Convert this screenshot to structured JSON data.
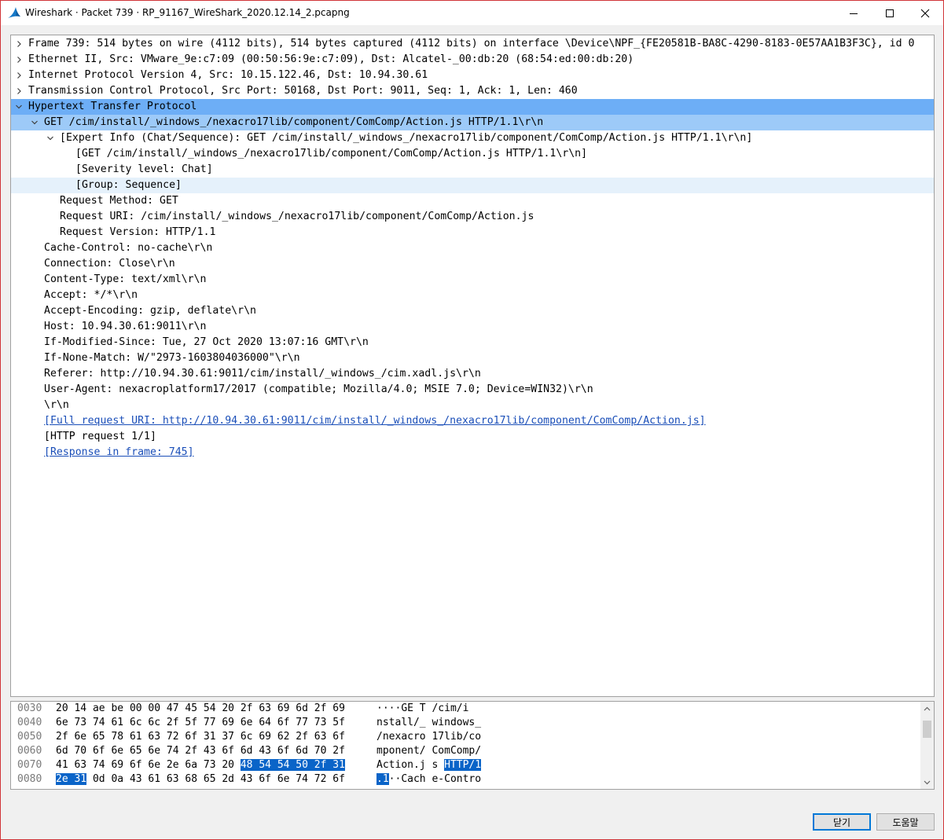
{
  "window": {
    "title": "Wireshark · Packet 739 · RP_91167_WireShark_2020.12.14_2.pcapng"
  },
  "tree": [
    {
      "indent": 0,
      "chevron": "right",
      "text": "Frame 739: 514 bytes on wire (4112 bits), 514 bytes captured (4112 bits) on interface \\Device\\NPF_{FE20581B-BA8C-4290-8183-0E57AA1B3F3C}, id 0",
      "state": ""
    },
    {
      "indent": 0,
      "chevron": "right",
      "text": "Ethernet II, Src: VMware_9e:c7:09 (00:50:56:9e:c7:09), Dst: Alcatel-_00:db:20 (68:54:ed:00:db:20)",
      "state": ""
    },
    {
      "indent": 0,
      "chevron": "right",
      "text": "Internet Protocol Version 4, Src: 10.15.122.46, Dst: 10.94.30.61",
      "state": ""
    },
    {
      "indent": 0,
      "chevron": "right",
      "text": "Transmission Control Protocol, Src Port: 50168, Dst Port: 9011, Seq: 1, Ack: 1, Len: 460",
      "state": ""
    },
    {
      "indent": 0,
      "chevron": "down",
      "text": "Hypertext Transfer Protocol",
      "state": "sel"
    },
    {
      "indent": 1,
      "chevron": "down",
      "text": "GET /cim/install/_windows_/nexacro17lib/component/ComComp/Action.js HTTP/1.1\\r\\n",
      "state": "sel2"
    },
    {
      "indent": 2,
      "chevron": "down",
      "text": "[Expert Info (Chat/Sequence): GET /cim/install/_windows_/nexacro17lib/component/ComComp/Action.js HTTP/1.1\\r\\n]",
      "state": ""
    },
    {
      "indent": 3,
      "chevron": "",
      "text": "[GET /cim/install/_windows_/nexacro17lib/component/ComComp/Action.js HTTP/1.1\\r\\n]",
      "state": ""
    },
    {
      "indent": 3,
      "chevron": "",
      "text": "[Severity level: Chat]",
      "state": ""
    },
    {
      "indent": 3,
      "chevron": "",
      "text": "[Group: Sequence]",
      "state": "hover"
    },
    {
      "indent": 2,
      "chevron": "",
      "text": "Request Method: GET",
      "state": ""
    },
    {
      "indent": 2,
      "chevron": "",
      "text": "Request URI: /cim/install/_windows_/nexacro17lib/component/ComComp/Action.js",
      "state": ""
    },
    {
      "indent": 2,
      "chevron": "",
      "text": "Request Version: HTTP/1.1",
      "state": ""
    },
    {
      "indent": 1,
      "chevron": "",
      "text": "Cache-Control: no-cache\\r\\n",
      "state": ""
    },
    {
      "indent": 1,
      "chevron": "",
      "text": "Connection: Close\\r\\n",
      "state": ""
    },
    {
      "indent": 1,
      "chevron": "",
      "text": "Content-Type: text/xml\\r\\n",
      "state": ""
    },
    {
      "indent": 1,
      "chevron": "",
      "text": "Accept: */*\\r\\n",
      "state": ""
    },
    {
      "indent": 1,
      "chevron": "",
      "text": "Accept-Encoding: gzip, deflate\\r\\n",
      "state": ""
    },
    {
      "indent": 1,
      "chevron": "",
      "text": "Host: 10.94.30.61:9011\\r\\n",
      "state": ""
    },
    {
      "indent": 1,
      "chevron": "",
      "text": "If-Modified-Since: Tue, 27 Oct 2020 13:07:16 GMT\\r\\n",
      "state": ""
    },
    {
      "indent": 1,
      "chevron": "",
      "text": "If-None-Match: W/\"2973-1603804036000\"\\r\\n",
      "state": ""
    },
    {
      "indent": 1,
      "chevron": "",
      "text": "Referer: http://10.94.30.61:9011/cim/install/_windows_/cim.xadl.js\\r\\n",
      "state": ""
    },
    {
      "indent": 1,
      "chevron": "",
      "text": "User-Agent: nexacroplatform17/2017 (compatible; Mozilla/4.0; MSIE 7.0; Device=WIN32)\\r\\n",
      "state": ""
    },
    {
      "indent": 1,
      "chevron": "",
      "text": "\\r\\n",
      "state": ""
    },
    {
      "indent": 1,
      "chevron": "",
      "text": "[Full request URI: http://10.94.30.61:9011/cim/install/_windows_/nexacro17lib/component/ComComp/Action.js]",
      "state": "link"
    },
    {
      "indent": 1,
      "chevron": "",
      "text": "[HTTP request 1/1]",
      "state": ""
    },
    {
      "indent": 1,
      "chevron": "",
      "text": "[Response in frame: 745]",
      "state": "link"
    }
  ],
  "hex": [
    {
      "offset": "0030",
      "bytes_a": "20 14 ae be 00 00 47 45",
      "bytes_b": "54 20 2f 63 69 6d 2f 69",
      "hl_b_from": -1,
      "hl_a_to": -1,
      "ascii_a": " ····GE",
      "ascii_b": "T /cim/i",
      "ascii_hl_b_from": -1,
      "ascii_hl_a_to": -1
    },
    {
      "offset": "0040",
      "bytes_a": "6e 73 74 61 6c 6c 2f 5f",
      "bytes_b": "77 69 6e 64 6f 77 73 5f",
      "hl_b_from": -1,
      "hl_a_to": -1,
      "ascii_a": "nstall/_",
      "ascii_b": "windows_",
      "ascii_hl_b_from": -1,
      "ascii_hl_a_to": -1
    },
    {
      "offset": "0050",
      "bytes_a": "2f 6e 65 78 61 63 72 6f",
      "bytes_b": "31 37 6c 69 62 2f 63 6f",
      "hl_b_from": -1,
      "hl_a_to": -1,
      "ascii_a": "/nexacro",
      "ascii_b": "17lib/co",
      "ascii_hl_b_from": -1,
      "ascii_hl_a_to": -1
    },
    {
      "offset": "0060",
      "bytes_a": "6d 70 6f 6e 65 6e 74 2f",
      "bytes_b": "43 6f 6d 43 6f 6d 70 2f",
      "hl_b_from": -1,
      "hl_a_to": -1,
      "ascii_a": "mponent/",
      "ascii_b": "ComComp/",
      "ascii_hl_b_from": -1,
      "ascii_hl_a_to": -1
    },
    {
      "offset": "0070",
      "bytes_a": "41 63 74 69 6f 6e 2e 6a",
      "bytes_b": "73 20 48 54 54 50 2f 31",
      "hl_b_from": 2,
      "hl_a_to": -1,
      "ascii_a": "Action.j",
      "ascii_b": "s HTTP/1",
      "ascii_hl_b_from": 2,
      "ascii_hl_a_to": -1
    },
    {
      "offset": "0080",
      "bytes_a": "2e 31 0d 0a 43 61 63 68",
      "bytes_b": "65 2d 43 6f 6e 74 72 6f",
      "hl_b_from": -1,
      "hl_a_to": 2,
      "ascii_a": ".1··Cach",
      "ascii_b": "e-Contro",
      "ascii_hl_b_from": -1,
      "ascii_hl_a_to": 2
    }
  ],
  "buttons": {
    "close_label": "닫기",
    "help_label": "도움말"
  },
  "colors": {
    "selection": "#6daef6",
    "selection_child": "#9dcaf8",
    "hover": "#e5f1fb",
    "hex_highlight": "#0a64c8",
    "link": "#1a4eb8",
    "window_border": "#d13438"
  },
  "icons": {
    "app": "wireshark-fin-icon",
    "minimize": "minimize-icon",
    "maximize": "maximize-icon",
    "close": "close-icon",
    "expand": "chevron-right-icon",
    "collapse": "chevron-down-icon"
  }
}
